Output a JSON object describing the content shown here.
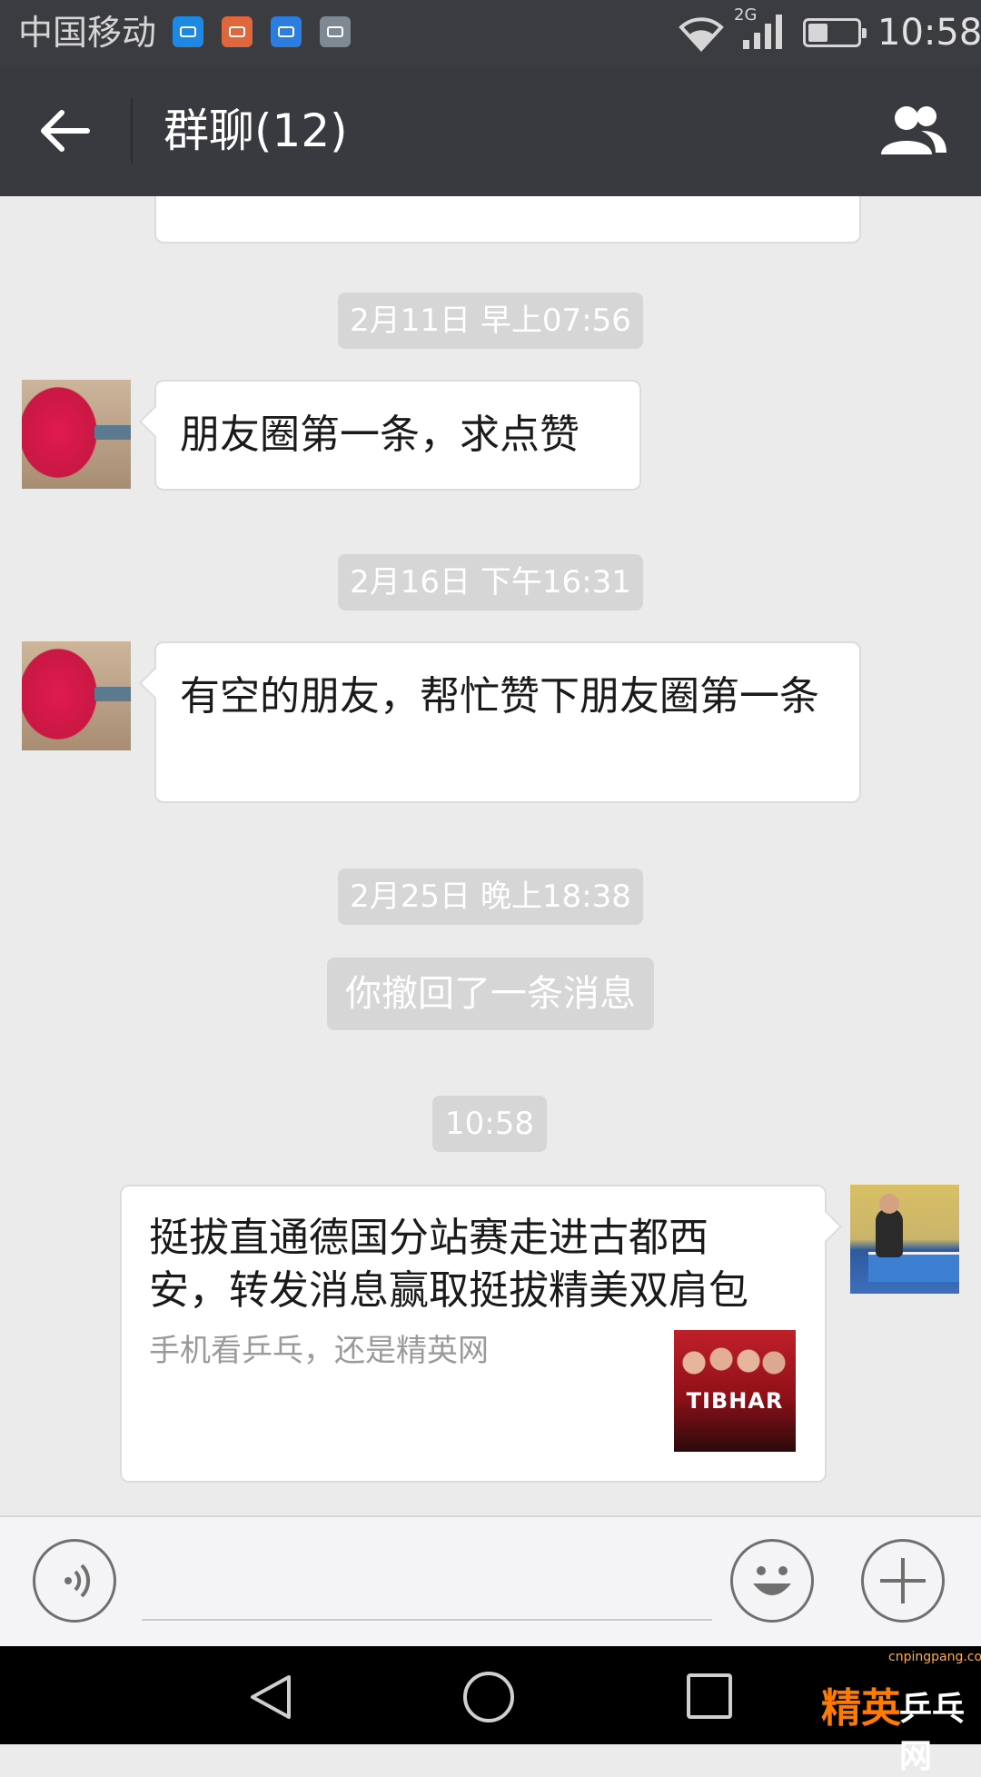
{
  "status_bar": {
    "carrier": "中国移动",
    "notification_icons": [
      "app-notification-icon",
      "mail-icon",
      "health-icon",
      "gallery-icon"
    ],
    "network": "2G",
    "battery_level": 0.4,
    "time": "10:58"
  },
  "header": {
    "title": "群聊(12)",
    "back_icon": "back-arrow-icon",
    "members_icon": "group-members-icon",
    "background": "#393a3f"
  },
  "chat": {
    "messages": [
      {
        "type": "timestamp",
        "text": "2月11日 早上07:56"
      },
      {
        "type": "text",
        "direction": "incoming",
        "avatar": "ping-pong-paddle-avatar",
        "text": "朋友圈第一条，求点赞"
      },
      {
        "type": "timestamp",
        "text": "2月16日 下午16:31"
      },
      {
        "type": "text",
        "direction": "incoming",
        "avatar": "ping-pong-paddle-avatar",
        "text": "有空的朋友，帮忙赞下朋友圈第一条"
      },
      {
        "type": "timestamp",
        "text": "2月25日 晚上18:38"
      },
      {
        "type": "system",
        "text": "你撤回了一条消息"
      },
      {
        "type": "timestamp",
        "text": "10:58"
      },
      {
        "type": "link",
        "direction": "outgoing",
        "avatar": "table-tennis-player-avatar",
        "title": "挺拔直通德国分站赛走进古都西安，转发消息赢取挺拔精美双肩包",
        "description": "手机看乒乓，还是精英网",
        "thumbnail_text": "TIBHAR"
      }
    ]
  },
  "input_bar": {
    "voice_icon": "voice-input-icon",
    "emoji_icon": "emoji-icon",
    "more_icon": "plus-icon",
    "text_value": ""
  },
  "nav_bar": {
    "back_icon": "nav-back-icon",
    "home_icon": "nav-home-icon",
    "recent_icon": "nav-recent-apps-icon"
  },
  "watermark": {
    "brand": "精英",
    "site": "乒乓网",
    "url": "cnpingpang.com"
  },
  "colors": {
    "chat_background": "#ebebeb",
    "bubble": "#ffffff",
    "timestamp_pill": "#d6d6d6",
    "title_bar": "#393a3f",
    "status_bar": "#3b3c40"
  }
}
